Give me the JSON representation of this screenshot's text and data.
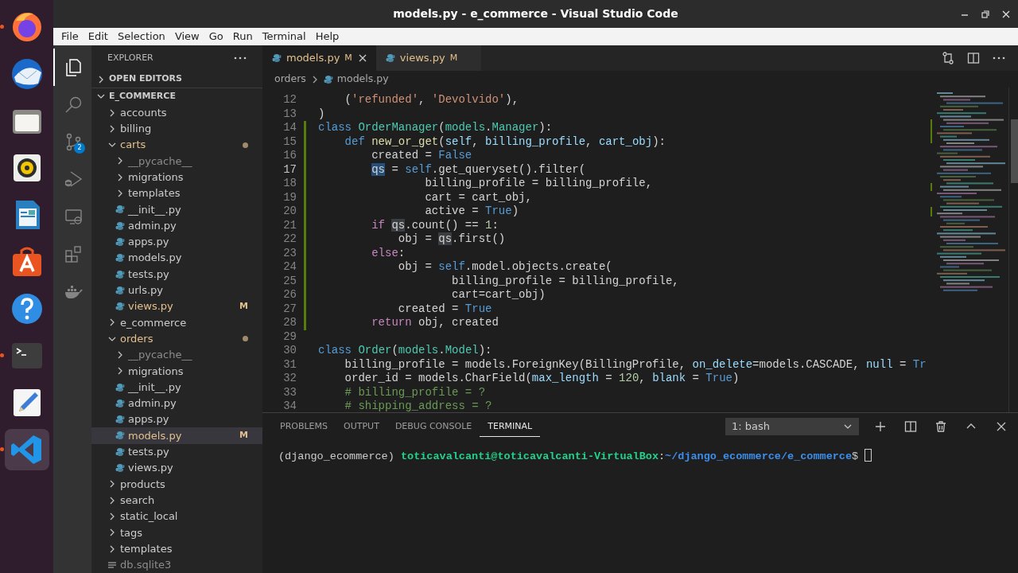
{
  "window": {
    "title": "models.py - e_commerce - Visual Studio Code"
  },
  "dock": [
    {
      "kind": "firefox",
      "running": true,
      "selected": false
    },
    {
      "kind": "mail",
      "running": false,
      "selected": false
    },
    {
      "kind": "files",
      "running": false,
      "selected": false
    },
    {
      "kind": "speaker",
      "running": false,
      "selected": false
    },
    {
      "kind": "writer",
      "running": false,
      "selected": false
    },
    {
      "kind": "store",
      "running": false,
      "selected": false
    },
    {
      "kind": "help",
      "running": false,
      "selected": false
    },
    {
      "kind": "terminal",
      "running": true,
      "selected": false
    },
    {
      "kind": "editor",
      "running": false,
      "selected": false
    },
    {
      "kind": "vscode",
      "running": true,
      "selected": true
    }
  ],
  "menu": [
    "File",
    "Edit",
    "Selection",
    "View",
    "Go",
    "Run",
    "Terminal",
    "Help"
  ],
  "activity_bar": [
    {
      "kind": "explorer",
      "selected": true
    },
    {
      "kind": "search",
      "selected": false
    },
    {
      "kind": "source-control",
      "selected": false,
      "badge": "2"
    },
    {
      "kind": "run",
      "selected": false
    },
    {
      "kind": "remote",
      "selected": false
    },
    {
      "kind": "extensions",
      "selected": false
    },
    {
      "kind": "docker",
      "selected": false
    }
  ],
  "sidebar": {
    "title": "EXPLORER",
    "sections": [
      {
        "label": "OPEN EDITORS",
        "expanded": false
      },
      {
        "label": "E_COMMERCE",
        "expanded": true
      }
    ],
    "tree": [
      {
        "label": "accounts",
        "kind": "folder",
        "expanded": false,
        "modified": false,
        "dimmed": false,
        "dot": false,
        "selected": false
      },
      {
        "label": "billing",
        "kind": "folder",
        "expanded": false,
        "modified": false,
        "dimmed": false,
        "dot": false,
        "selected": false
      },
      {
        "label": "carts",
        "kind": "folder",
        "expanded": true,
        "modified": true,
        "dimmed": false,
        "dot": true,
        "selected": false,
        "children": [
          {
            "label": "__pycache__",
            "kind": "folder",
            "expanded": false,
            "modified": false,
            "dimmed": true,
            "dot": false,
            "selected": false
          },
          {
            "label": "migrations",
            "kind": "folder",
            "expanded": false,
            "modified": false,
            "dimmed": false,
            "dot": false,
            "selected": false
          },
          {
            "label": "templates",
            "kind": "folder",
            "expanded": false,
            "modified": false,
            "dimmed": false,
            "dot": false,
            "selected": false
          },
          {
            "label": "__init__.py",
            "kind": "python",
            "modified": false,
            "dimmed": false,
            "selected": false
          },
          {
            "label": "admin.py",
            "kind": "python",
            "modified": false,
            "dimmed": false,
            "selected": false
          },
          {
            "label": "apps.py",
            "kind": "python",
            "modified": false,
            "dimmed": false,
            "selected": false
          },
          {
            "label": "models.py",
            "kind": "python",
            "modified": false,
            "dimmed": false,
            "selected": false
          },
          {
            "label": "tests.py",
            "kind": "python",
            "modified": false,
            "dimmed": false,
            "selected": false
          },
          {
            "label": "urls.py",
            "kind": "python",
            "modified": false,
            "dimmed": false,
            "selected": false
          },
          {
            "label": "views.py",
            "kind": "python",
            "modified": true,
            "dimmed": false,
            "selected": false,
            "badge": "M"
          }
        ]
      },
      {
        "label": "e_commerce",
        "kind": "folder",
        "expanded": false,
        "modified": false,
        "dimmed": false,
        "dot": false,
        "selected": false
      },
      {
        "label": "orders",
        "kind": "folder",
        "expanded": true,
        "modified": true,
        "dimmed": false,
        "dot": true,
        "selected": false,
        "children": [
          {
            "label": "__pycache__",
            "kind": "folder",
            "expanded": false,
            "modified": false,
            "dimmed": true,
            "dot": false,
            "selected": false
          },
          {
            "label": "migrations",
            "kind": "folder",
            "expanded": false,
            "modified": false,
            "dimmed": false,
            "dot": false,
            "selected": false
          },
          {
            "label": "__init__.py",
            "kind": "python",
            "modified": false,
            "dimmed": false,
            "selected": false
          },
          {
            "label": "admin.py",
            "kind": "python",
            "modified": false,
            "dimmed": false,
            "selected": false
          },
          {
            "label": "apps.py",
            "kind": "python",
            "modified": false,
            "dimmed": false,
            "selected": false
          },
          {
            "label": "models.py",
            "kind": "python",
            "modified": true,
            "dimmed": false,
            "selected": true,
            "badge": "M"
          },
          {
            "label": "tests.py",
            "kind": "python",
            "modified": false,
            "dimmed": false,
            "selected": false
          },
          {
            "label": "views.py",
            "kind": "python",
            "modified": false,
            "dimmed": false,
            "selected": false
          }
        ]
      },
      {
        "label": "products",
        "kind": "folder",
        "expanded": false,
        "modified": false,
        "dimmed": false,
        "dot": false,
        "selected": false
      },
      {
        "label": "search",
        "kind": "folder",
        "expanded": false,
        "modified": false,
        "dimmed": false,
        "dot": false,
        "selected": false
      },
      {
        "label": "static_local",
        "kind": "folder",
        "expanded": false,
        "modified": false,
        "dimmed": false,
        "dot": false,
        "selected": false
      },
      {
        "label": "tags",
        "kind": "folder",
        "expanded": false,
        "modified": false,
        "dimmed": false,
        "dot": false,
        "selected": false
      },
      {
        "label": "templates",
        "kind": "folder",
        "expanded": false,
        "modified": false,
        "dimmed": false,
        "dot": false,
        "selected": false
      },
      {
        "label": "db.sqlite3",
        "kind": "database",
        "modified": false,
        "dimmed": true,
        "selected": false
      }
    ]
  },
  "editor": {
    "tabs": [
      {
        "label": "models.py",
        "status": "M",
        "modified": true,
        "selected": true
      },
      {
        "label": "views.py",
        "status": "M",
        "modified": true,
        "selected": false
      }
    ],
    "breadcrumb": [
      {
        "label": "orders",
        "kind": "folder"
      },
      {
        "label": "models.py",
        "kind": "python"
      }
    ],
    "lines": [
      {
        "n": "12",
        "changed": false,
        "current": false,
        "tokens": [
          {
            "text": "    (",
            "kind": "plain"
          },
          {
            "text": "'refunded'",
            "kind": "string"
          },
          {
            "text": ", ",
            "kind": "plain"
          },
          {
            "text": "'Devolvido'",
            "kind": "string"
          },
          {
            "text": "),",
            "kind": "plain"
          }
        ]
      },
      {
        "n": "13",
        "changed": false,
        "current": false,
        "tokens": [
          {
            "text": ")",
            "kind": "plain"
          }
        ]
      },
      {
        "n": "14",
        "changed": true,
        "current": false,
        "tokens": [
          {
            "text": "class ",
            "kind": "keyword"
          },
          {
            "text": "OrderManager",
            "kind": "class"
          },
          {
            "text": "(",
            "kind": "plain"
          },
          {
            "text": "models",
            "kind": "class"
          },
          {
            "text": ".",
            "kind": "plain"
          },
          {
            "text": "Manager",
            "kind": "class"
          },
          {
            "text": "):",
            "kind": "plain"
          }
        ]
      },
      {
        "n": "15",
        "changed": true,
        "current": false,
        "tokens": [
          {
            "text": "    def ",
            "kind": "keyword"
          },
          {
            "text": "new_or_get",
            "kind": "function"
          },
          {
            "text": "(",
            "kind": "plain"
          },
          {
            "text": "self",
            "kind": "variable"
          },
          {
            "text": ", ",
            "kind": "plain"
          },
          {
            "text": "billing_profile",
            "kind": "variable"
          },
          {
            "text": ", ",
            "kind": "plain"
          },
          {
            "text": "cart_obj",
            "kind": "variable"
          },
          {
            "text": "):",
            "kind": "plain"
          }
        ]
      },
      {
        "n": "16",
        "changed": true,
        "current": false,
        "tokens": [
          {
            "text": "        created = ",
            "kind": "plain"
          },
          {
            "text": "False",
            "kind": "keyword"
          }
        ]
      },
      {
        "n": "17",
        "changed": true,
        "current": true,
        "tokens": [
          {
            "text": "        qs",
            "kind": "selection"
          },
          {
            "text": " = ",
            "kind": "plain"
          },
          {
            "text": "self",
            "kind": "keyword"
          },
          {
            "text": ".get_queryset().filter(",
            "kind": "plain"
          }
        ]
      },
      {
        "n": "18",
        "changed": true,
        "current": false,
        "tokens": [
          {
            "text": "                billing_profile = billing_profile,",
            "kind": "plain"
          }
        ]
      },
      {
        "n": "19",
        "changed": true,
        "current": false,
        "tokens": [
          {
            "text": "                cart = cart_obj,",
            "kind": "plain"
          }
        ]
      },
      {
        "n": "20",
        "changed": true,
        "current": false,
        "tokens": [
          {
            "text": "                active = ",
            "kind": "plain"
          },
          {
            "text": "True",
            "kind": "keyword"
          },
          {
            "text": ")",
            "kind": "plain"
          }
        ]
      },
      {
        "n": "21",
        "changed": true,
        "current": false,
        "tokens": [
          {
            "text": "        if ",
            "kind": "control"
          },
          {
            "text": "qs",
            "kind": "occurrence"
          },
          {
            "text": ".count() == ",
            "kind": "plain"
          },
          {
            "text": "1",
            "kind": "number"
          },
          {
            "text": ":",
            "kind": "plain"
          }
        ]
      },
      {
        "n": "22",
        "changed": true,
        "current": false,
        "tokens": [
          {
            "text": "            obj = ",
            "kind": "plain"
          },
          {
            "text": "qs",
            "kind": "occurrence"
          },
          {
            "text": ".first()",
            "kind": "plain"
          }
        ]
      },
      {
        "n": "23",
        "changed": true,
        "current": false,
        "tokens": [
          {
            "text": "        else",
            "kind": "control"
          },
          {
            "text": ":",
            "kind": "plain"
          }
        ]
      },
      {
        "n": "24",
        "changed": true,
        "current": false,
        "tokens": [
          {
            "text": "            obj = ",
            "kind": "plain"
          },
          {
            "text": "self",
            "kind": "keyword"
          },
          {
            "text": ".model.objects.create(",
            "kind": "plain"
          }
        ]
      },
      {
        "n": "25",
        "changed": true,
        "current": false,
        "tokens": [
          {
            "text": "                    billing_profile = billing_profile,",
            "kind": "plain"
          }
        ]
      },
      {
        "n": "26",
        "changed": true,
        "current": false,
        "tokens": [
          {
            "text": "                    cart=cart_obj)",
            "kind": "plain"
          }
        ]
      },
      {
        "n": "27",
        "changed": true,
        "current": false,
        "tokens": [
          {
            "text": "            created = ",
            "kind": "plain"
          },
          {
            "text": "True",
            "kind": "keyword"
          }
        ]
      },
      {
        "n": "28",
        "changed": true,
        "current": false,
        "tokens": [
          {
            "text": "        return",
            "kind": "control"
          },
          {
            "text": " obj, created",
            "kind": "plain"
          }
        ]
      },
      {
        "n": "29",
        "changed": false,
        "current": false
      },
      {
        "n": "30",
        "changed": false,
        "current": false,
        "tokens": [
          {
            "text": "class ",
            "kind": "keyword"
          },
          {
            "text": "Order",
            "kind": "class"
          },
          {
            "text": "(",
            "kind": "plain"
          },
          {
            "text": "models",
            "kind": "class"
          },
          {
            "text": ".",
            "kind": "plain"
          },
          {
            "text": "Model",
            "kind": "class"
          },
          {
            "text": "):",
            "kind": "plain"
          }
        ]
      },
      {
        "n": "31",
        "changed": false,
        "current": false,
        "tokens": [
          {
            "text": "    billing_profile = models.ForeignKey(BillingProfile, ",
            "kind": "plain"
          },
          {
            "text": "on_delete",
            "kind": "variable"
          },
          {
            "text": "=models.CASCADE, ",
            "kind": "plain"
          },
          {
            "text": "null",
            "kind": "variable"
          },
          {
            "text": " = ",
            "kind": "plain"
          },
          {
            "text": "Tr",
            "kind": "keyword"
          }
        ]
      },
      {
        "n": "32",
        "changed": false,
        "current": false,
        "tokens": [
          {
            "text": "    order_id = models.CharField(",
            "kind": "plain"
          },
          {
            "text": "max_length",
            "kind": "variable"
          },
          {
            "text": " = ",
            "kind": "plain"
          },
          {
            "text": "120",
            "kind": "number"
          },
          {
            "text": ", ",
            "kind": "plain"
          },
          {
            "text": "blank",
            "kind": "variable"
          },
          {
            "text": " = ",
            "kind": "plain"
          },
          {
            "text": "True",
            "kind": "keyword"
          },
          {
            "text": ")",
            "kind": "plain"
          }
        ]
      },
      {
        "n": "33",
        "changed": false,
        "current": false,
        "tokens": [
          {
            "text": "    # billing_profile = ?",
            "kind": "comment"
          }
        ]
      },
      {
        "n": "34",
        "changed": false,
        "current": false,
        "tokens": [
          {
            "text": "    # shipping_address = ?",
            "kind": "comment"
          }
        ]
      }
    ]
  },
  "panel": {
    "tabs": [
      {
        "label": "PROBLEMS",
        "selected": false
      },
      {
        "label": "OUTPUT",
        "selected": false
      },
      {
        "label": "DEBUG CONSOLE",
        "selected": false
      },
      {
        "label": "TERMINAL",
        "selected": true
      }
    ],
    "terminal": {
      "session": "1: bash",
      "prompt": [
        {
          "text": "(django_ecommerce) ",
          "kind": "plain"
        },
        {
          "text": "toticavalcanti@toticavalcanti-VirtualBox",
          "kind": "user"
        },
        {
          "text": ":",
          "kind": "plain"
        },
        {
          "text": "~/django_ecommerce/e_commerce",
          "kind": "path"
        },
        {
          "text": "$ ",
          "kind": "plain"
        }
      ]
    }
  }
}
